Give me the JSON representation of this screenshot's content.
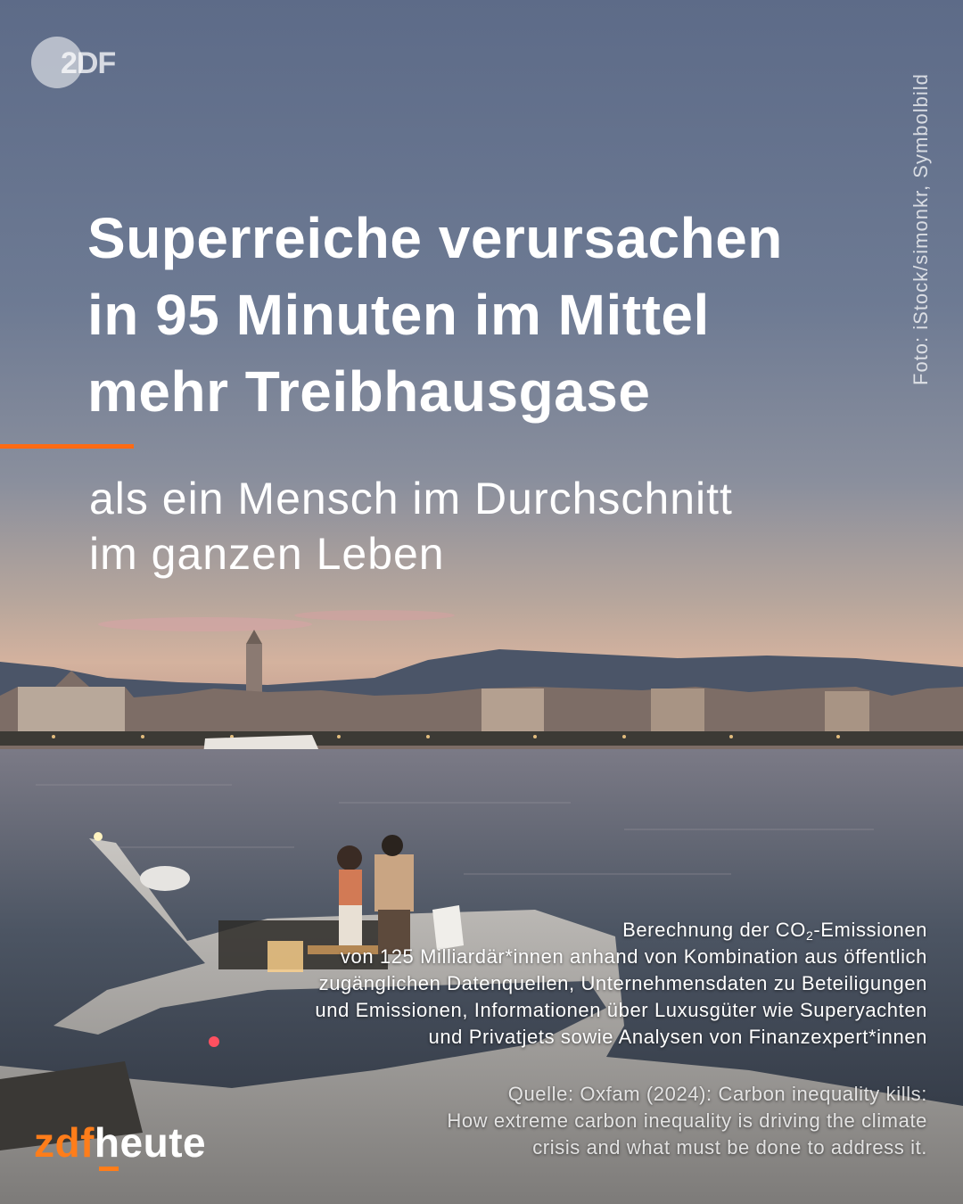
{
  "brand": {
    "top_logo_text": "2DF",
    "footer_part1": "zdf",
    "footer_part2": "heute",
    "accent_color": "#ff6a13"
  },
  "photo_credit": "Foto: iStock/simonkr, Symbolbild",
  "headline": "Superreiche verursachen\nin 95 Minuten im Mittel\nmehr Treibhausgase",
  "subline": "als ein Mensch im Durchschnitt\nim ganzen Leben",
  "methodology": {
    "part1": "Berechnung der CO",
    "subscript": "2",
    "part2": "-Emissionen",
    "rest": "von 125 Milliardär*innen anhand von Kombination aus öffentlich zugänglichen Datenquellen, Unternehmensdaten zu Beteiligungen und Emissionen, Informationen über Luxusgüter wie Superyachten und Privatjets sowie Analysen von Finanzexpert*innen"
  },
  "source": "Quelle: Oxfam (2024): Carbon inequality kills:\nHow extreme carbon inequality is driving the climate\ncrisis and what must be done to address it.",
  "background_image": "sunset-harbor-yacht-photo"
}
